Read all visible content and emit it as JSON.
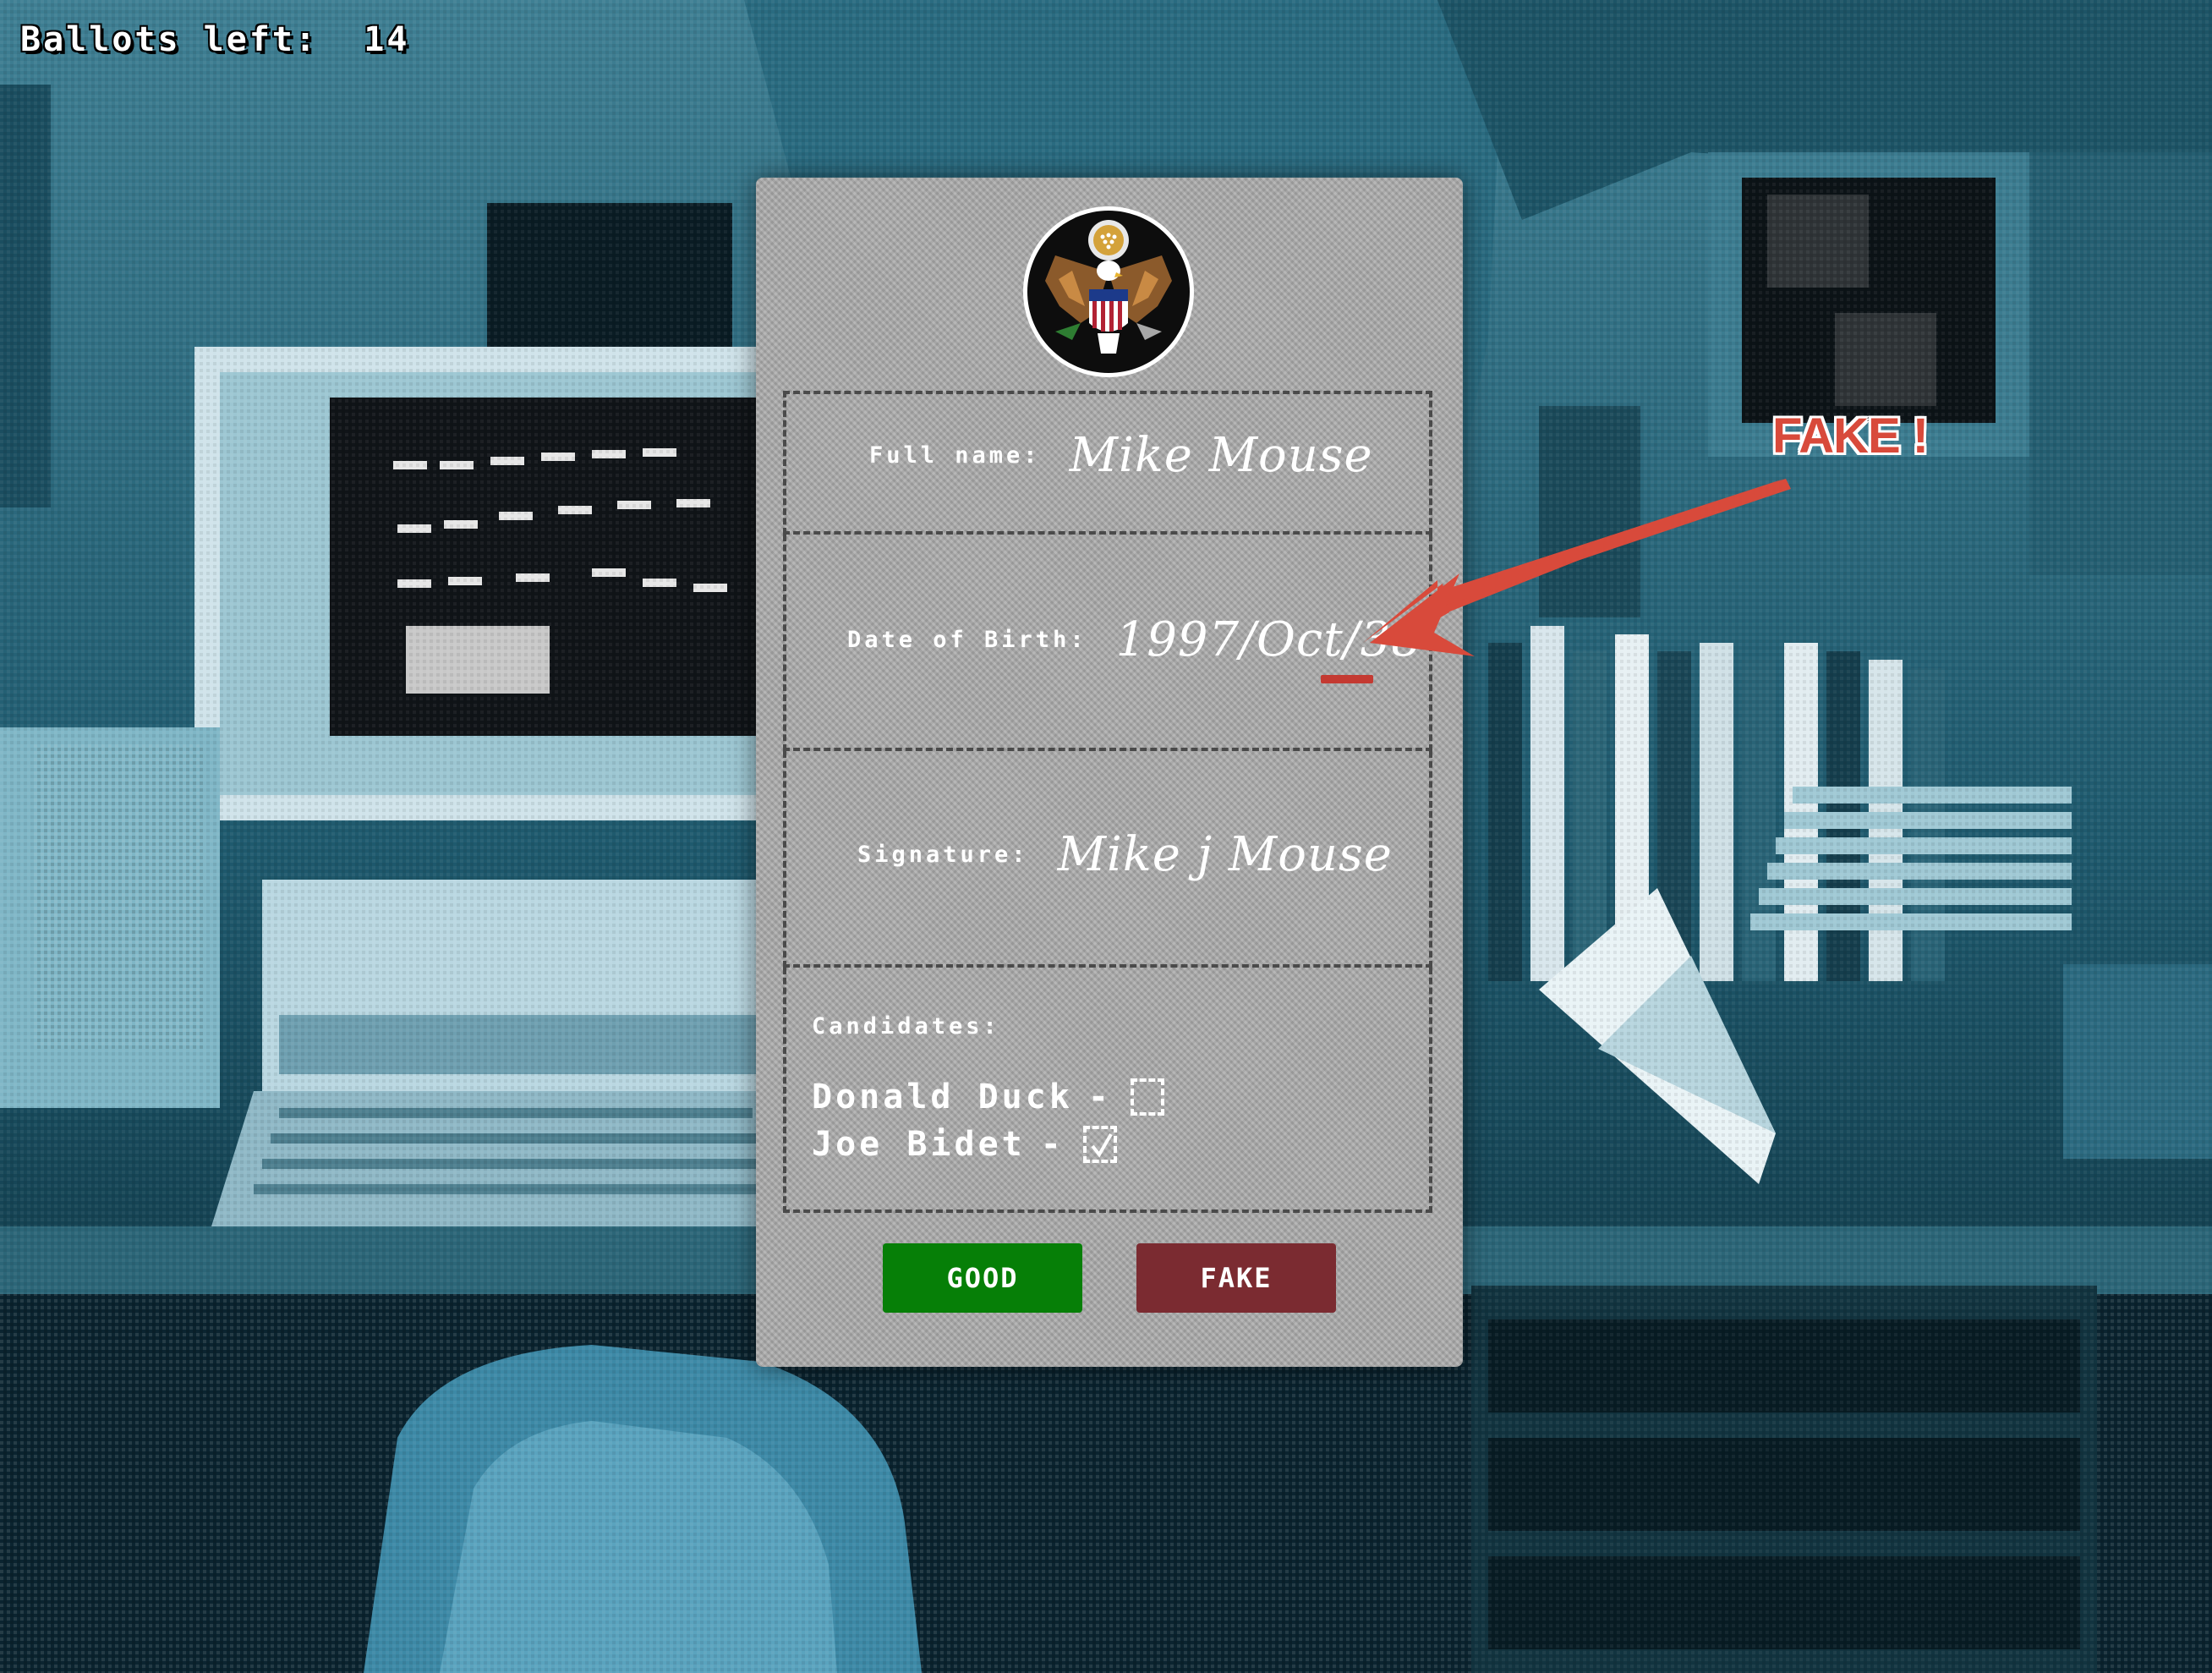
{
  "hud": {
    "ballots_left_label": "Ballots left:",
    "ballots_left_value": "14"
  },
  "ballot": {
    "seal_icon": "us-great-seal-eagle-icon",
    "full_name": {
      "label": "Full name:",
      "value": "Mike Mouse"
    },
    "date_of_birth": {
      "label": "Date of Birth:",
      "value": "1997/Oct/38"
    },
    "signature": {
      "label": "Signature:",
      "value": "Mike j Mouse"
    },
    "candidates": {
      "label": "Candidates:",
      "items": [
        {
          "name": "Donald Duck",
          "separator": "-",
          "checked": false
        },
        {
          "name": "Joe Bidet",
          "separator": "-",
          "checked": true
        }
      ]
    },
    "buttons": {
      "good_label": "GOOD",
      "fake_label": "FAKE"
    }
  },
  "annotation": {
    "label": "FAKE !",
    "color": "#d84a3b"
  },
  "colors": {
    "good_button": "#067f07",
    "fake_button": "#7b2b31",
    "card": "#a9a9a9",
    "highlight_underline": "#c43a32"
  }
}
